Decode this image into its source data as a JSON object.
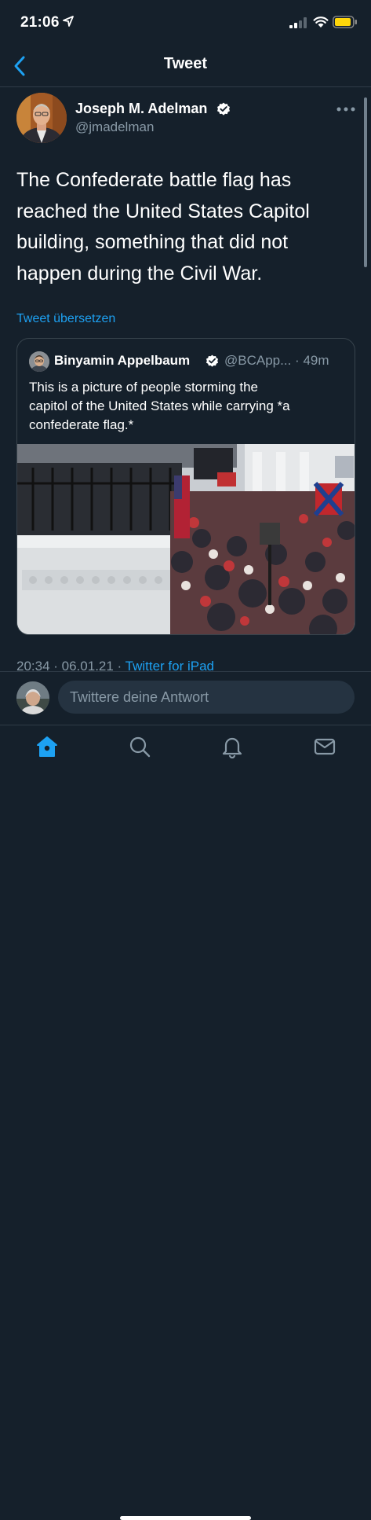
{
  "status": {
    "time": "21:06"
  },
  "nav": {
    "title": "Tweet"
  },
  "author": {
    "name": "Joseph M. Adelman",
    "handle": "@jmadelman"
  },
  "tweet": {
    "lines": [
      "The Confederate battle flag has",
      "reached the United States Capitol",
      "building, something that did not",
      "happen during the Civil War."
    ],
    "translate": "Tweet übersetzen"
  },
  "quote": {
    "name": "Binyamin Appelbaum",
    "handle": "@BCApp...",
    "separator": "·",
    "time": "49m",
    "lines": [
      "This is a picture of people storming the",
      "capitol of the United States while carrying *a",
      "confederate flag.*"
    ]
  },
  "meta": {
    "timestamp": "20:34 · 06.01.21 · ",
    "app": "Twitter for iPad"
  },
  "reply": {
    "placeholder": "Twittere deine Antwort"
  },
  "tabs": [
    "home-icon",
    "search-icon",
    "notifications-icon",
    "messages-icon"
  ],
  "colors": {
    "background": "#15202b",
    "accent": "#1da1f2",
    "secondary_text": "#8899a6",
    "battery": "#ffd60a"
  }
}
